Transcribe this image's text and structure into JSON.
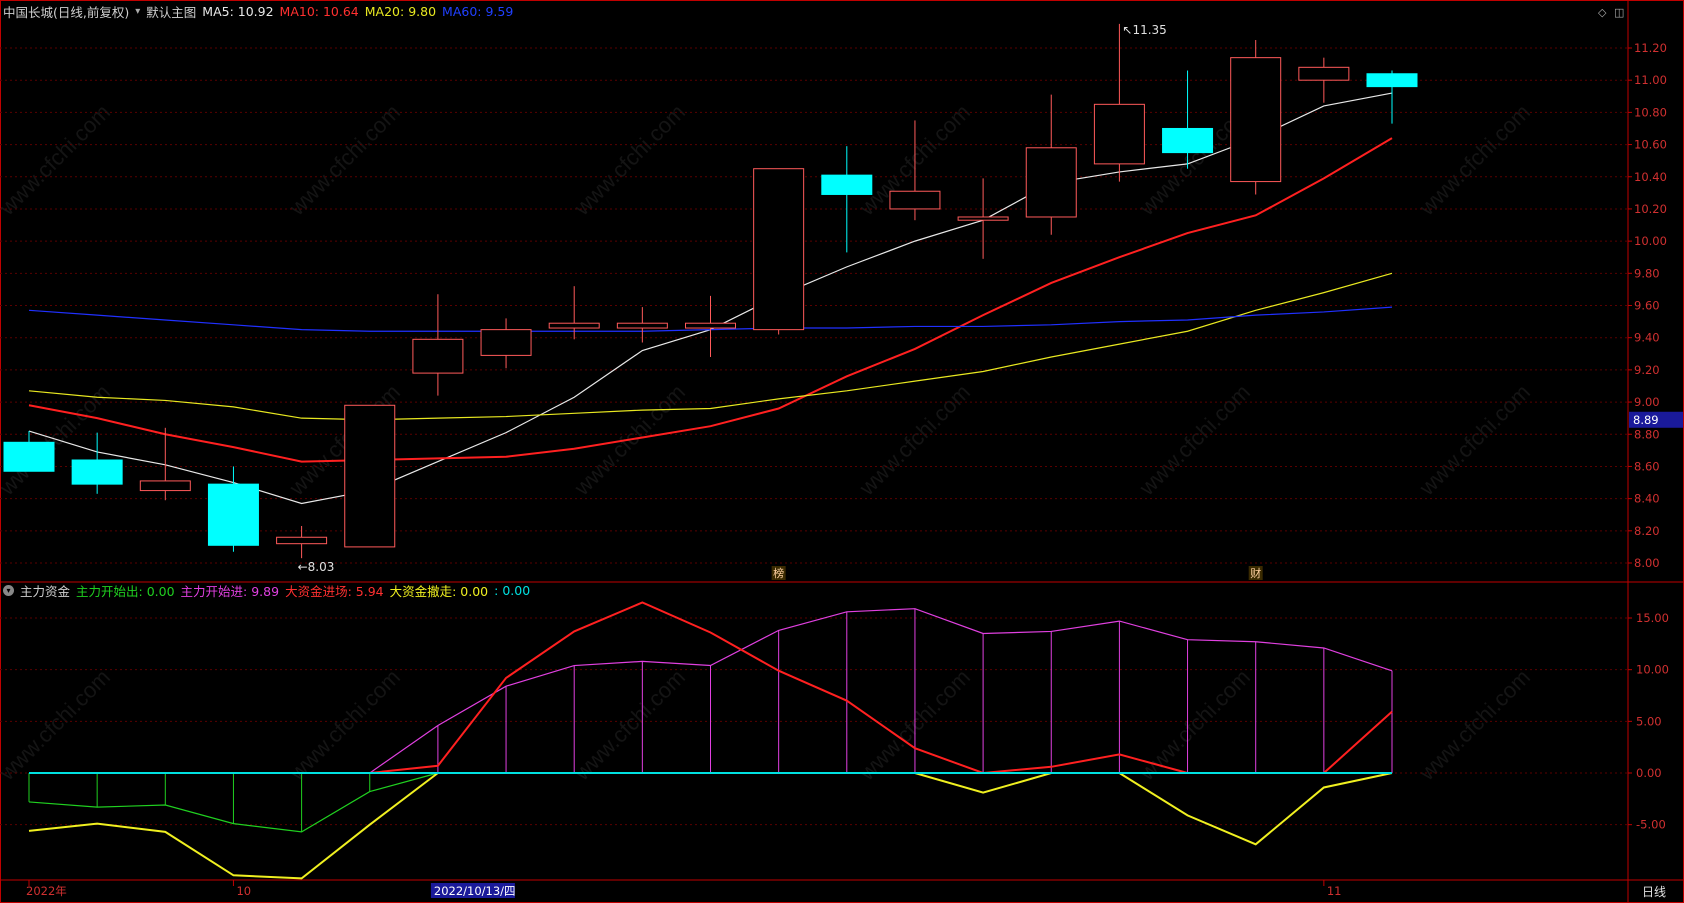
{
  "header": {
    "stock_name": "中国长城(日线,前复权)",
    "main_chart_label": "默认主图",
    "ma5": "MA5: 10.92",
    "ma10": "MA10: 10.64",
    "ma20": "MA20: 9.80",
    "ma60": "MA60: 9.59"
  },
  "sub_header": {
    "title": "主力资金",
    "out_label": "主力开始出: 0.00",
    "in_label": "主力开始进: 9.89",
    "big_in_label": "大资金进场: 5.94",
    "big_out_label": "大资金撤走: 0.00",
    "extra_label": ": 0.00"
  },
  "colors": {
    "up": "#ff5a5a",
    "down": "#00ffff",
    "ma5": "#e8e8e8",
    "ma10": "#ff2020",
    "ma20": "#e8e820",
    "ma60": "#2030ff",
    "axis": "#c00000",
    "magenta": "#e040e0",
    "green": "#20d020",
    "yellow": "#f0f020",
    "cyan": "#00e0e0"
  },
  "chart_data": [
    {
      "type": "candlestick",
      "title": "中国长城(日线,前复权)",
      "ylim": [
        7.95,
        11.3
      ],
      "yticks": [
        "11.20",
        "11.00",
        "10.80",
        "10.60",
        "10.40",
        "10.20",
        "10.00",
        "9.80",
        "9.60",
        "9.40",
        "9.20",
        "9.00",
        "8.80",
        "8.60",
        "8.40",
        "8.20",
        "8.00"
      ],
      "current_price_label": "8.89",
      "high_label": "11.35",
      "low_label": "8.03",
      "high_index": 16,
      "low_index": 4,
      "event_markers": [
        {
          "index": 11,
          "text": "榜"
        },
        {
          "index": 18,
          "text": "财"
        }
      ],
      "candles": [
        {
          "o": 8.75,
          "h": 8.82,
          "l": 8.57,
          "c": 8.57
        },
        {
          "o": 8.64,
          "h": 8.81,
          "l": 8.43,
          "c": 8.49
        },
        {
          "o": 8.45,
          "h": 8.84,
          "l": 8.39,
          "c": 8.51
        },
        {
          "o": 8.49,
          "h": 8.6,
          "l": 8.07,
          "c": 8.11
        },
        {
          "o": 8.12,
          "h": 8.23,
          "l": 8.03,
          "c": 8.16
        },
        {
          "o": 8.1,
          "h": 8.98,
          "l": 8.1,
          "c": 8.98
        },
        {
          "o": 9.18,
          "h": 9.67,
          "l": 9.04,
          "c": 9.39
        },
        {
          "o": 9.29,
          "h": 9.52,
          "l": 9.21,
          "c": 9.45
        },
        {
          "o": 9.46,
          "h": 9.72,
          "l": 9.39,
          "c": 9.49
        },
        {
          "o": 9.46,
          "h": 9.59,
          "l": 9.37,
          "c": 9.49
        },
        {
          "o": 9.46,
          "h": 9.66,
          "l": 9.28,
          "c": 9.49
        },
        {
          "o": 9.45,
          "h": 10.45,
          "l": 9.42,
          "c": 10.45
        },
        {
          "o": 10.41,
          "h": 10.59,
          "l": 9.93,
          "c": 10.29
        },
        {
          "o": 10.2,
          "h": 10.75,
          "l": 10.13,
          "c": 10.31
        },
        {
          "o": 10.13,
          "h": 10.39,
          "l": 9.89,
          "c": 10.15
        },
        {
          "o": 10.15,
          "h": 10.91,
          "l": 10.04,
          "c": 10.58
        },
        {
          "o": 10.48,
          "h": 11.35,
          "l": 10.37,
          "c": 10.85
        },
        {
          "o": 10.7,
          "h": 11.06,
          "l": 10.45,
          "c": 10.55
        },
        {
          "o": 10.37,
          "h": 11.25,
          "l": 10.29,
          "c": 11.14
        },
        {
          "o": 11.0,
          "h": 11.14,
          "l": 10.86,
          "c": 11.08
        },
        {
          "o": 11.04,
          "h": 11.06,
          "l": 10.73,
          "c": 10.96
        }
      ],
      "series": [
        {
          "name": "MA5",
          "values": [
            8.82,
            8.69,
            8.61,
            8.5,
            8.37,
            8.45,
            8.63,
            8.81,
            9.03,
            9.32,
            9.45,
            9.66,
            9.84,
            10.0,
            10.13,
            10.36,
            10.43,
            10.48,
            10.64,
            10.84,
            10.92
          ]
        },
        {
          "name": "MA10",
          "values": [
            8.98,
            8.9,
            8.8,
            8.72,
            8.63,
            8.64,
            8.65,
            8.66,
            8.71,
            8.78,
            8.85,
            8.96,
            9.16,
            9.33,
            9.54,
            9.74,
            9.9,
            10.05,
            10.16,
            10.39,
            10.64
          ]
        },
        {
          "name": "MA20",
          "values": [
            9.07,
            9.03,
            9.01,
            8.97,
            8.9,
            8.89,
            8.9,
            8.91,
            8.93,
            8.95,
            8.96,
            9.02,
            9.07,
            9.13,
            9.19,
            9.28,
            9.36,
            9.44,
            9.57,
            9.68,
            9.8
          ]
        },
        {
          "name": "MA60",
          "values": [
            9.57,
            9.54,
            9.51,
            9.48,
            9.45,
            9.44,
            9.44,
            9.44,
            9.44,
            9.44,
            9.45,
            9.46,
            9.46,
            9.47,
            9.47,
            9.48,
            9.5,
            9.51,
            9.54,
            9.56,
            9.59
          ]
        }
      ]
    },
    {
      "type": "line",
      "title": "主力资金",
      "ylim": [
        -10.5,
        16.5
      ],
      "yticks": [
        "15.00",
        "10.00",
        "5.00",
        "0.00",
        "-5.00"
      ],
      "x_labels": [
        {
          "index": 0,
          "text": "2022年"
        },
        {
          "index": 3,
          "text": "10"
        },
        {
          "index": 6,
          "text": "2022/10/13/四"
        },
        {
          "index": 19,
          "text": "11"
        }
      ],
      "period_label": "日线",
      "series": [
        {
          "name": "主力开始出",
          "values": [
            -2.8,
            -3.3,
            -3.1,
            -4.9,
            -5.7,
            -1.8,
            0,
            null,
            null,
            null,
            null,
            null,
            null,
            null,
            null,
            null,
            null,
            null,
            null,
            null,
            null
          ]
        },
        {
          "name": "主力开始进",
          "values": [
            null,
            null,
            null,
            null,
            null,
            0,
            4.6,
            8.4,
            10.4,
            10.8,
            10.4,
            13.8,
            15.6,
            15.9,
            13.5,
            13.7,
            14.7,
            12.9,
            12.7,
            12.1,
            9.89
          ]
        },
        {
          "name": "大资金进场",
          "values": [
            null,
            null,
            null,
            null,
            null,
            0,
            0.7,
            9.2,
            13.7,
            16.5,
            13.6,
            9.9,
            7.0,
            2.4,
            0,
            0.6,
            1.8,
            0,
            null,
            0,
            5.94
          ]
        },
        {
          "name": "大资金撤走",
          "values": [
            -5.6,
            -4.9,
            -5.7,
            -9.9,
            -10.2,
            -5.0,
            0,
            null,
            null,
            null,
            null,
            null,
            null,
            0,
            -1.9,
            0,
            0,
            -4.1,
            -6.9,
            -1.4,
            0
          ]
        },
        {
          "name": "zero",
          "values": [
            0,
            0,
            0,
            0,
            0,
            0,
            0,
            0,
            0,
            0,
            0,
            0,
            0,
            0,
            0,
            0,
            0,
            0,
            0,
            0,
            0
          ]
        }
      ]
    }
  ],
  "watermark": "www.cfchi.com"
}
